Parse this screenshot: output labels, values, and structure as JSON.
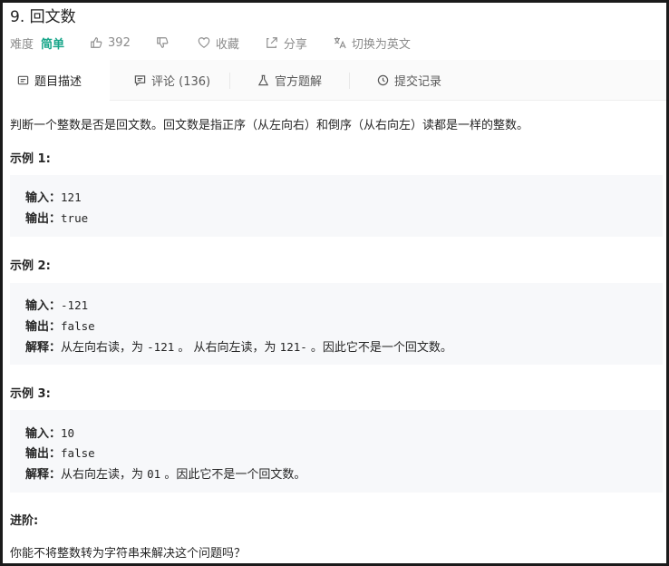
{
  "problem": {
    "title": "9. 回文数"
  },
  "meta": {
    "difficulty_label": "难度",
    "difficulty_value": "简单",
    "likes": "392",
    "favorite": "收藏",
    "share": "分享",
    "translate": "切换为英文"
  },
  "tabs": [
    {
      "label": "题目描述"
    },
    {
      "label": "评论 (136)"
    },
    {
      "label": "官方题解"
    },
    {
      "label": "提交记录"
    }
  ],
  "description": "判断一个整数是否是回文数。回文数是指正序（从左向右）和倒序（从右向左）读都是一样的整数。",
  "labels": {
    "input": "输入：",
    "output": "输出：",
    "explain": "解释："
  },
  "examples": [
    {
      "title": "示例 1:",
      "input": "121",
      "output": "true"
    },
    {
      "title": "示例 2:",
      "input": "-121",
      "output": "false",
      "explain_a": "从左向右读，为 ",
      "explain_code1": "-121",
      "explain_b": " 。 从右向左读，为 ",
      "explain_code2": "121-",
      "explain_c": " 。因此它不是一个回文数。"
    },
    {
      "title": "示例 3:",
      "input": "10",
      "output": "false",
      "explain_a": "从右向左读，为 ",
      "explain_code1": "01",
      "explain_b": " 。因此它不是一个回文数。"
    }
  ],
  "advanced": {
    "title": "进阶:",
    "text": "你能不将整数转为字符串来解决这个问题吗？"
  },
  "colors": {
    "accent": "#17a589",
    "tab_bg": "#fafafa",
    "code_bg": "#f7f8fa"
  }
}
